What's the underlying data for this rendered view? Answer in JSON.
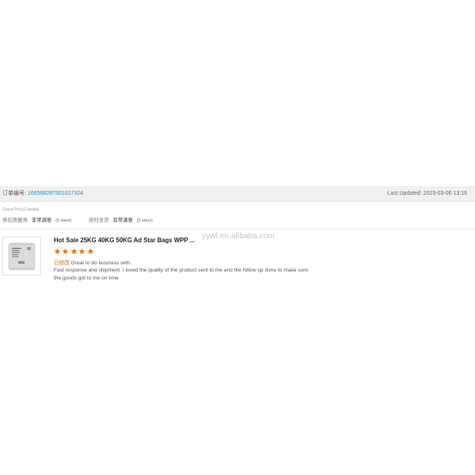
{
  "order": {
    "label": "订单编号:",
    "number": "166568287501027324",
    "last_updated_label": "Last Updated:",
    "last_updated": "2023-03-06 13:16"
  },
  "buyer": {
    "name_location": "Grace Perry,Canada"
  },
  "ratings": [
    {
      "label": "供应商服务",
      "value": "非常满意",
      "stars_text": "(5 stars)"
    },
    {
      "label": "按时发货",
      "value": "非常满意",
      "stars_text": "(5 stars)"
    }
  ],
  "product": {
    "title": "Hot Sale 25KG 40KG 50KG Ad Star Bags WPP ...",
    "rating": 5,
    "star_color": "#ff6a00",
    "thumbnail_icon": "woven-bag-icon"
  },
  "watermark": "yywl.en.alibaba.com",
  "review": {
    "modified_label": "已修改:",
    "first_line": "Great to do business with.",
    "body": "Fast response and shipment. I loved the quality of the product sent to me and the follow up done to make sure the goods got to me on time"
  },
  "colors": {
    "link": "#1a8fd6",
    "header_bg": "#f0f0f0",
    "star": "#ff6a00",
    "modified": "#c86b00"
  }
}
